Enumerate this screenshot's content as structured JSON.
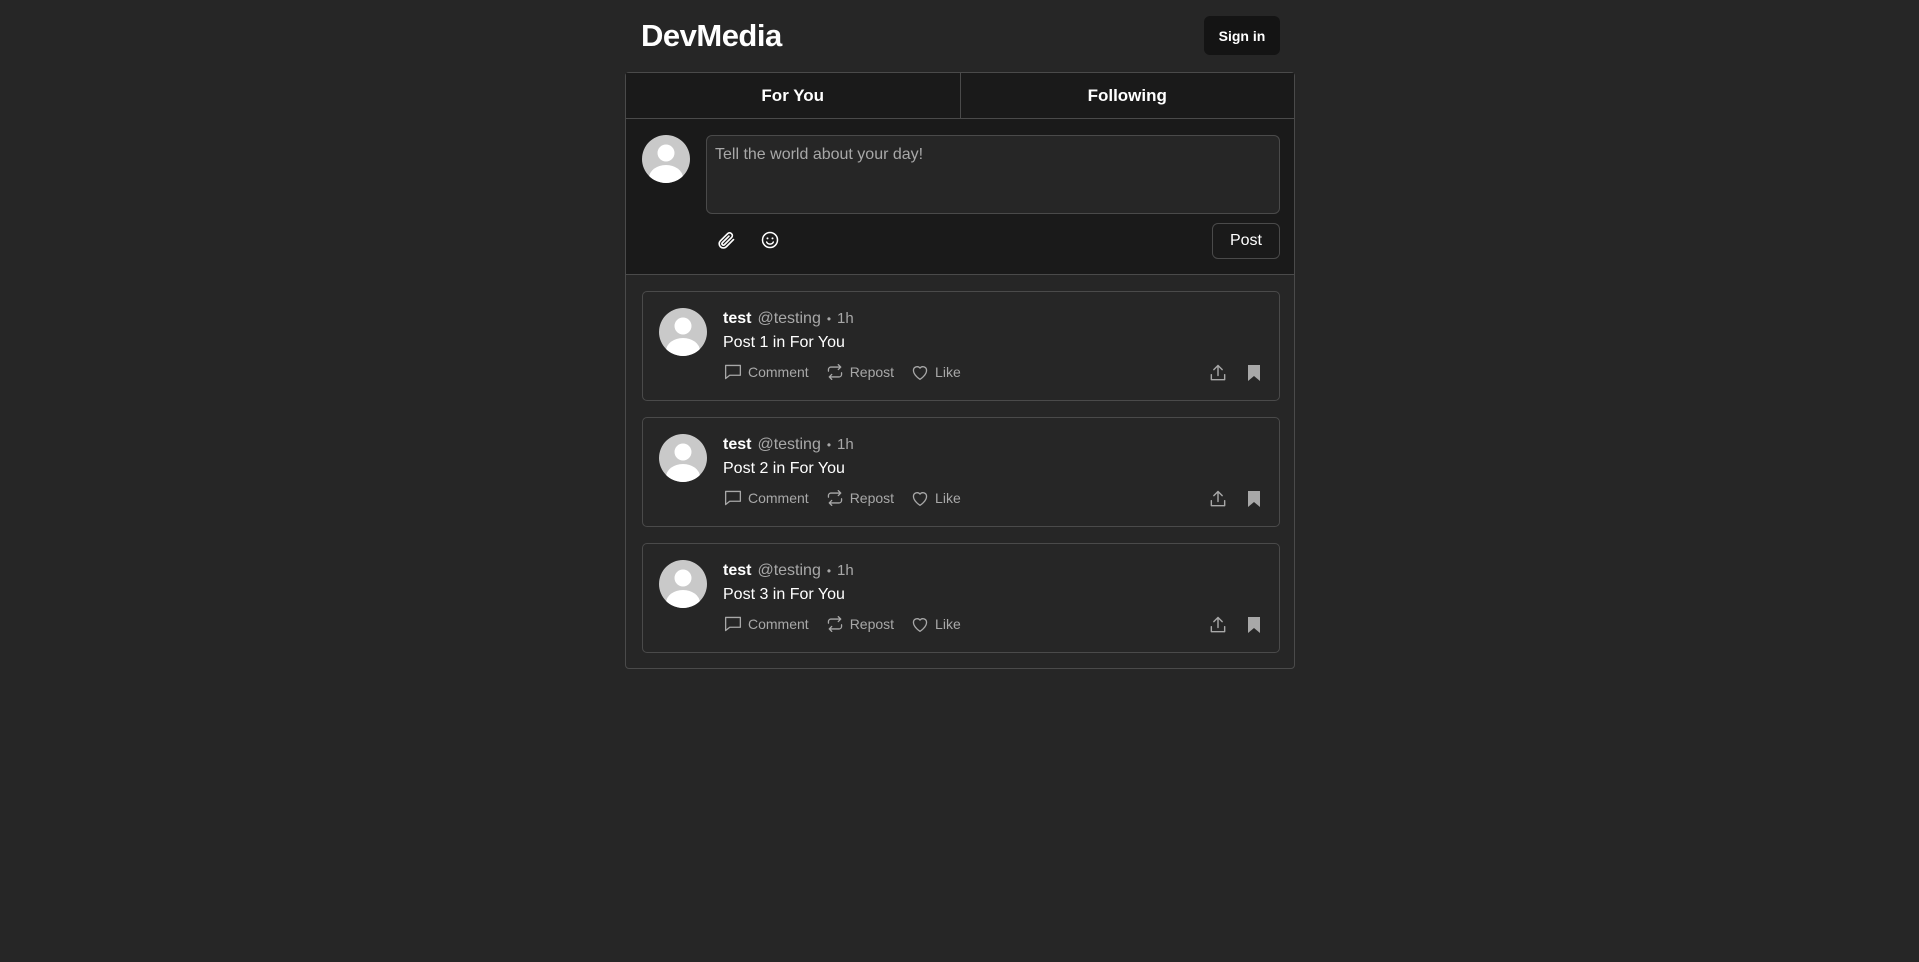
{
  "header": {
    "brand": "DevMedia",
    "signin_label": "Sign in"
  },
  "tabs": [
    {
      "label": "For You",
      "active": true
    },
    {
      "label": "Following",
      "active": false
    }
  ],
  "composer": {
    "placeholder": "Tell the world about your day!",
    "value": "",
    "attach_icon": "paperclip-icon",
    "emoji_icon": "smiley-icon",
    "post_label": "Post"
  },
  "posts": [
    {
      "author": "test",
      "handle": "@testing",
      "separator": "•",
      "time": "1h",
      "body": "Post 1 in For You",
      "comment_label": "Comment",
      "repost_label": "Repost",
      "like_label": "Like"
    },
    {
      "author": "test",
      "handle": "@testing",
      "separator": "•",
      "time": "1h",
      "body": "Post 2 in For You",
      "comment_label": "Comment",
      "repost_label": "Repost",
      "like_label": "Like"
    },
    {
      "author": "test",
      "handle": "@testing",
      "separator": "•",
      "time": "1h",
      "body": "Post 3 in For You",
      "comment_label": "Comment",
      "repost_label": "Repost",
      "like_label": "Like"
    }
  ],
  "colors": {
    "background": "#262626",
    "panel": "#1a1a1a",
    "border": "#4a4a4a",
    "muted_text": "#a8a8a8",
    "avatar": "#c9c9c9"
  }
}
